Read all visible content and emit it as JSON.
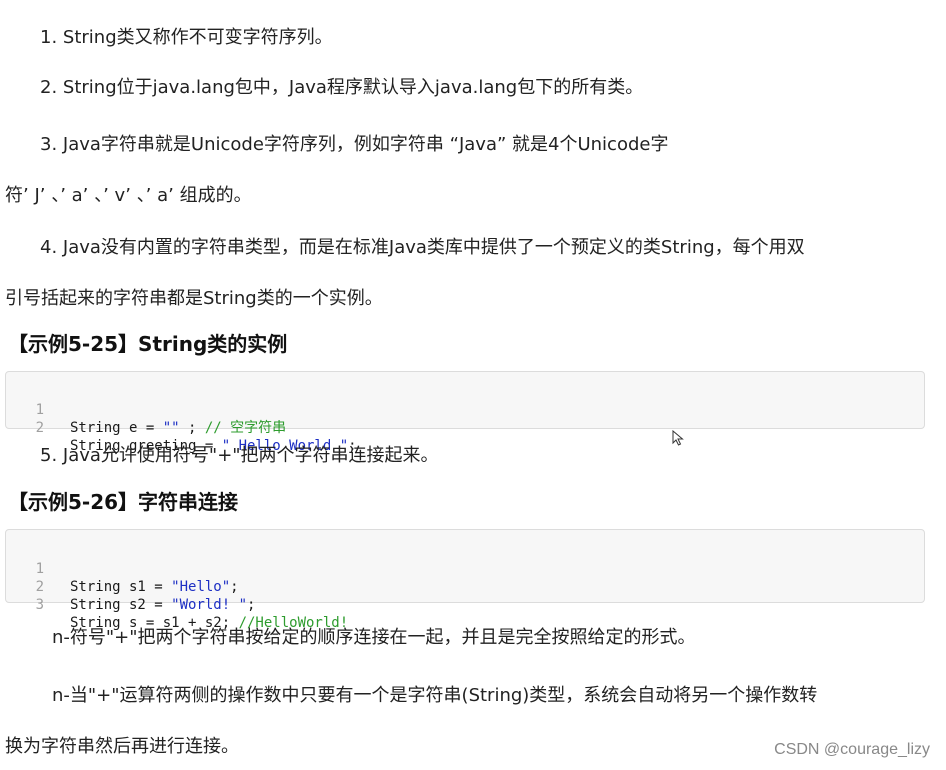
{
  "paragraphs": {
    "p1": "1. String类又称作不可变字符序列。",
    "p2": "2. String位于java.lang包中，Java程序默认导入java.lang包下的所有类。",
    "p3_line1": "3. Java字符串就是Unicode字符序列，例如字符串 “Java” 就是4个Unicode字",
    "p3_line2": "符’ J’ 、’ a’ 、’ v’ 、’ a’ 组成的。",
    "p4_line1": "4.  Java没有内置的字符串类型，而是在标准Java类库中提供了一个预定义的类String，每个用双",
    "p4_line2": "引号括起来的字符串都是String类的一个实例。",
    "p5": "5. Java允许使用符号\"+\"把两个字符串连接起来。",
    "n1": "n-符号\"+\"把两个字符串按给定的顺序连接在一起，并且是完全按照给定的形式。",
    "n2_line1": "n-当\"+\"运算符两侧的操作数中只要有一个是字符串(String)类型，系统会自动将另一个操作数转",
    "n2_line2": "换为字符串然后再进行连接。"
  },
  "example1": {
    "heading": "【示例5-25】String类的实例",
    "lines": [
      {
        "no": "1",
        "a": "String e = ",
        "s": "\"\"",
        "b": " ; ",
        "c": "// 空字符串"
      },
      {
        "no": "2",
        "a": "String greeting = ",
        "s": "\" Hello World \"",
        "b": ";",
        "c": ""
      }
    ]
  },
  "example2": {
    "heading": "【示例5-26】字符串连接",
    "lines": [
      {
        "no": "1",
        "a": "String s1 = ",
        "s": "\"Hello\"",
        "b": ";",
        "c": ""
      },
      {
        "no": "2",
        "a": "String s2 = ",
        "s": "\"World! \"",
        "b": ";",
        "c": ""
      },
      {
        "no": "3",
        "a": "String s = s1 + s2; ",
        "s": "",
        "b": "",
        "c": "//HelloWorld!"
      }
    ]
  },
  "icons": {
    "cursor": "mouse-pointer-icon"
  },
  "watermark": "CSDN @courage_lizy",
  "colors": {
    "string_literal": "#1d2fc4",
    "comment": "#2e9c2e",
    "line_number": "#a0a0a0",
    "code_background": "#f7f7f7"
  }
}
